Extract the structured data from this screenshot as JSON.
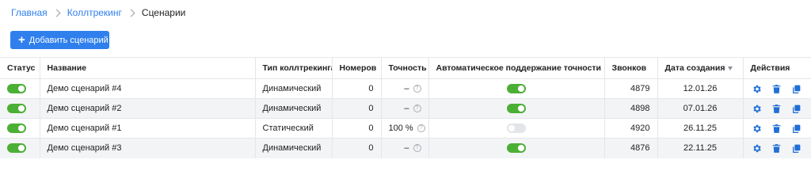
{
  "breadcrumb": {
    "items": [
      "Главная",
      "Коллтрекинг"
    ],
    "current": "Сценарии"
  },
  "toolbar": {
    "add_label": "Добавить сценарий"
  },
  "table": {
    "headers": {
      "status": "Статус",
      "name": "Название",
      "type": "Тип коллтрекинга",
      "numbers": "Номеров",
      "accuracy": "Точность",
      "auto": "Автоматическое поддержание точности",
      "calls": "Звонков",
      "created": "Дата создания",
      "actions": "Действия"
    },
    "rows": [
      {
        "status_on": true,
        "name": "Демо сценарий #4",
        "type": "Динамический",
        "numbers": "0",
        "accuracy": "–",
        "auto_on": true,
        "calls": "4879",
        "created": "12.01.26"
      },
      {
        "status_on": true,
        "name": "Демо сценарий #2",
        "type": "Динамический",
        "numbers": "0",
        "accuracy": "–",
        "auto_on": true,
        "calls": "4898",
        "created": "07.01.26"
      },
      {
        "status_on": true,
        "name": "Демо сценарий #1",
        "type": "Статический",
        "numbers": "0",
        "accuracy": "100 %",
        "auto_on": false,
        "calls": "4920",
        "created": "26.11.25"
      },
      {
        "status_on": true,
        "name": "Демо сценарий #3",
        "type": "Динамический",
        "numbers": "0",
        "accuracy": "–",
        "auto_on": true,
        "calls": "4876",
        "created": "22.11.25"
      }
    ]
  },
  "icons": {
    "settings": "gear-icon",
    "delete": "trash-icon",
    "copy": "copy-icon",
    "help": "question-icon",
    "add": "plus-icon"
  },
  "colors": {
    "accent": "#2f80ed",
    "toggle_on": "#4caf35",
    "toggle_off": "#e3e5e8",
    "icon": "#1f6fd6",
    "row_alt": "#f3f4f6"
  }
}
